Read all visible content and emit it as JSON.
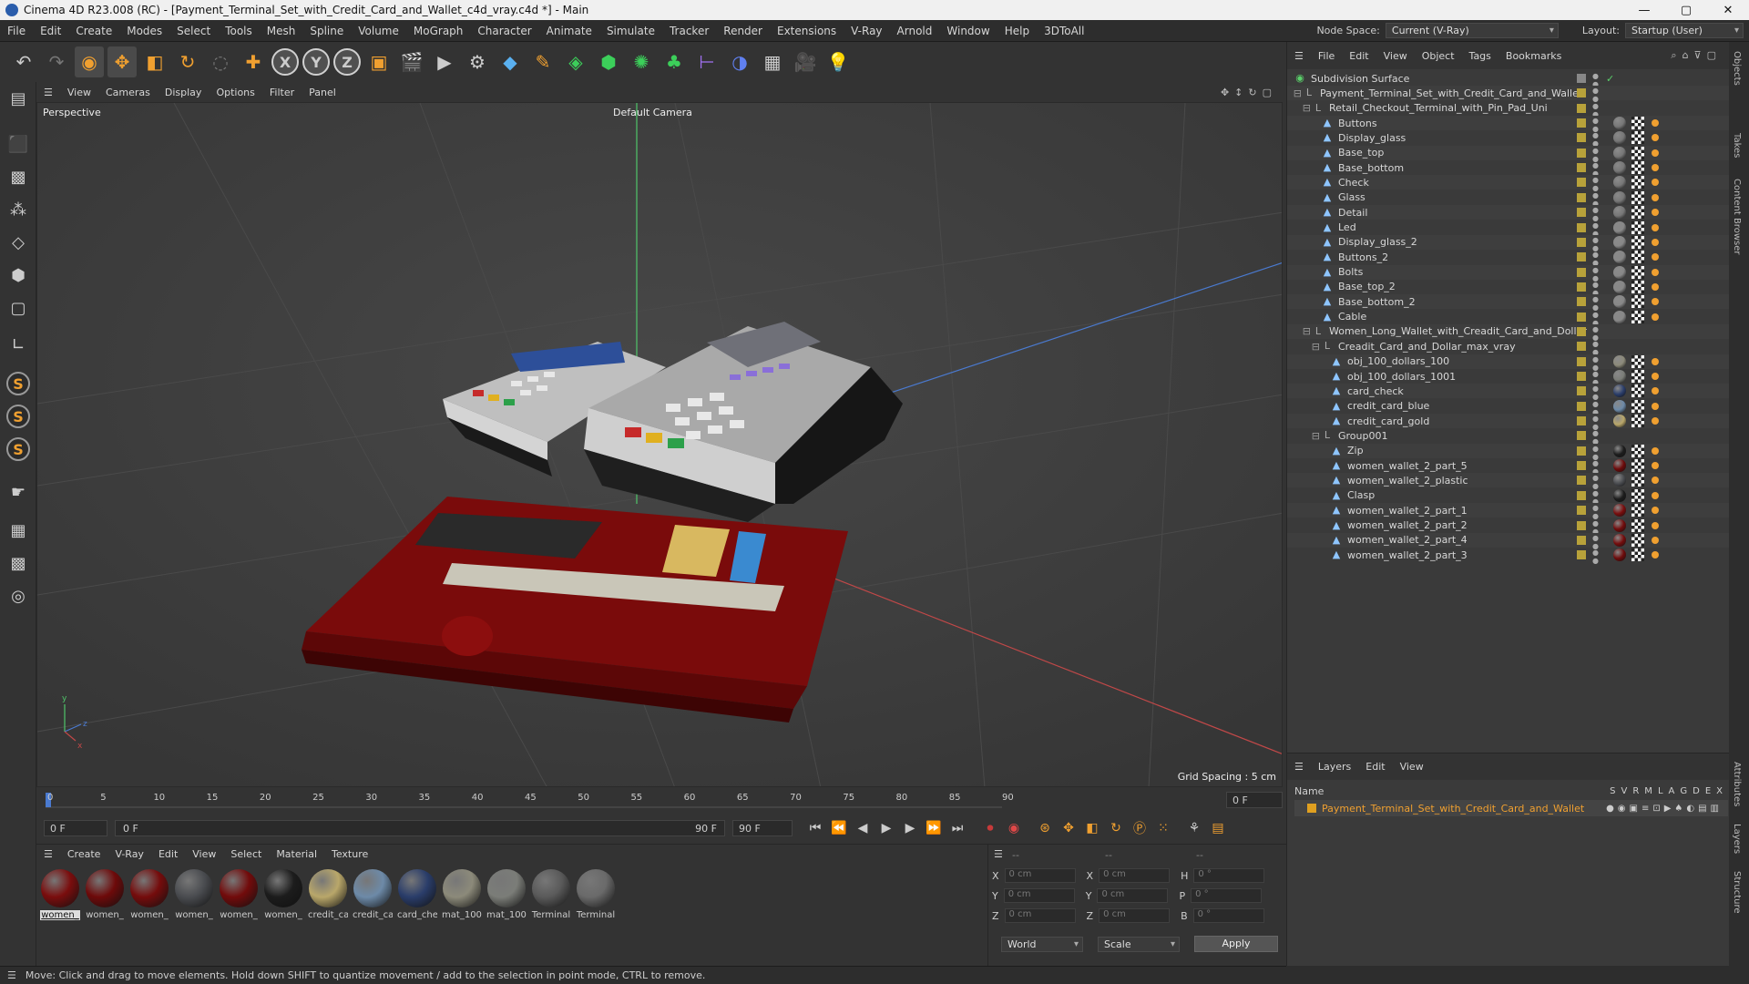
{
  "window": {
    "title": "Cinema 4D R23.008 (RC) - [Payment_Terminal_Set_with_Credit_Card_and_Wallet_c4d_vray.c4d *] - Main",
    "controls": [
      "—",
      "▢",
      "✕"
    ]
  },
  "menubar": {
    "items": [
      "File",
      "Edit",
      "Create",
      "Modes",
      "Select",
      "Tools",
      "Mesh",
      "Spline",
      "Volume",
      "MoGraph",
      "Character",
      "Animate",
      "Simulate",
      "Tracker",
      "Render",
      "Extensions",
      "V-Ray",
      "Arnold",
      "Window",
      "Help",
      "3DToAll"
    ],
    "node_space_label": "Node Space:",
    "node_space_value": "Current (V-Ray)",
    "layout_label": "Layout:",
    "layout_value": "Startup (User)"
  },
  "toolbar": {
    "axis_x": "X",
    "axis_y": "Y",
    "axis_z": "Z"
  },
  "left_tools": {
    "s1": "S",
    "s2": "S",
    "s3": "S"
  },
  "viewport": {
    "menu": [
      "View",
      "Cameras",
      "Display",
      "Options",
      "Filter",
      "Panel"
    ],
    "name": "Perspective",
    "camera": "Default Camera",
    "grid_spacing": "Grid Spacing : 5 cm"
  },
  "timeline": {
    "ticks": [
      "0",
      "5",
      "10",
      "15",
      "20",
      "25",
      "30",
      "35",
      "40",
      "45",
      "50",
      "55",
      "60",
      "65",
      "70",
      "75",
      "80",
      "85",
      "90"
    ],
    "end_field": "0 F",
    "start": "0 F",
    "current": "0 F",
    "range_end": "90 F",
    "max": "90 F"
  },
  "material_manager": {
    "menu": [
      "Create",
      "V-Ray",
      "Edit",
      "View",
      "Select",
      "Material",
      "Texture"
    ],
    "materials": [
      {
        "name": "women_",
        "color": "#7a0d0d"
      },
      {
        "name": "women_",
        "color": "#6e0a0a"
      },
      {
        "name": "women_",
        "color": "#750c0c"
      },
      {
        "name": "women_",
        "color": "#4a4c50"
      },
      {
        "name": "women_",
        "color": "#720b0b"
      },
      {
        "name": "women_",
        "color": "#1c1c1c"
      },
      {
        "name": "credit_ca",
        "color": "#b9a76a"
      },
      {
        "name": "credit_ca",
        "color": "#6d8aa8"
      },
      {
        "name": "card_che",
        "color": "#2a3d6a"
      },
      {
        "name": "mat_100",
        "color": "#8c8a7a"
      },
      {
        "name": "mat_100",
        "color": "#7b7d78"
      },
      {
        "name": "Terminal",
        "color": "#5a5a5a"
      },
      {
        "name": "Terminal",
        "color": "#6a6a6a"
      }
    ]
  },
  "coordinates": {
    "header": [
      "--",
      "--",
      "--"
    ],
    "rows": [
      {
        "a": "X",
        "av": "0 cm",
        "b": "X",
        "bv": "0 cm",
        "c": "H",
        "cv": "0 °"
      },
      {
        "a": "Y",
        "av": "0 cm",
        "b": "Y",
        "bv": "0 cm",
        "c": "P",
        "cv": "0 °"
      },
      {
        "a": "Z",
        "av": "0 cm",
        "b": "Z",
        "bv": "0 cm",
        "c": "B",
        "cv": "0 °"
      }
    ],
    "mode1": "World",
    "mode2": "Scale",
    "apply": "Apply"
  },
  "status": "Move: Click and drag to move elements. Hold down SHIFT to quantize movement / add to the selection in point mode, CTRL to remove.",
  "object_manager": {
    "menu": [
      "File",
      "Edit",
      "View",
      "Object",
      "Tags",
      "Bookmarks"
    ],
    "rows": [
      {
        "name": "Subdivision Surface",
        "indent": 0,
        "type": "sub",
        "tag": ""
      },
      {
        "name": "Payment_Terminal_Set_with_Credit_Card_and_Wallet",
        "indent": 1,
        "type": "null",
        "tag": ""
      },
      {
        "name": "Retail_Checkout_Terminal_with_Pin_Pad_Uni",
        "indent": 2,
        "type": "null",
        "tag": ""
      },
      {
        "name": "Buttons",
        "indent": 3,
        "type": "obj",
        "tag": "#777"
      },
      {
        "name": "Display_glass",
        "indent": 3,
        "type": "obj",
        "tag": "#777"
      },
      {
        "name": "Base_top",
        "indent": 3,
        "type": "obj",
        "tag": "#777"
      },
      {
        "name": "Base_bottom",
        "indent": 3,
        "type": "obj",
        "tag": "#777"
      },
      {
        "name": "Check",
        "indent": 3,
        "type": "obj",
        "tag": "#777"
      },
      {
        "name": "Glass",
        "indent": 3,
        "type": "obj",
        "tag": "#777"
      },
      {
        "name": "Detail",
        "indent": 3,
        "type": "obj",
        "tag": "#777"
      },
      {
        "name": "Led",
        "indent": 3,
        "type": "obj",
        "tag": "#888"
      },
      {
        "name": "Display_glass_2",
        "indent": 3,
        "type": "obj",
        "tag": "#888"
      },
      {
        "name": "Buttons_2",
        "indent": 3,
        "type": "obj",
        "tag": "#888"
      },
      {
        "name": "Bolts",
        "indent": 3,
        "type": "obj",
        "tag": "#888"
      },
      {
        "name": "Base_top_2",
        "indent": 3,
        "type": "obj",
        "tag": "#888"
      },
      {
        "name": "Base_bottom_2",
        "indent": 3,
        "type": "obj",
        "tag": "#888"
      },
      {
        "name": "Cable",
        "indent": 3,
        "type": "obj",
        "tag": "#888"
      },
      {
        "name": "Women_Long_Wallet_with_Creadit_Card_and_Dollar",
        "indent": 2,
        "type": "null",
        "tag": ""
      },
      {
        "name": "Creadit_Card_and_Dollar_max_vray",
        "indent": 3,
        "type": "null",
        "tag": ""
      },
      {
        "name": "obj_100_dollars_100",
        "indent": 4,
        "type": "obj",
        "tag": "#8c8a7a"
      },
      {
        "name": "obj_100_dollars_1001",
        "indent": 4,
        "type": "obj",
        "tag": "#7b7d78"
      },
      {
        "name": "card_check",
        "indent": 4,
        "type": "obj",
        "tag": "#2a3d6a"
      },
      {
        "name": "credit_card_blue",
        "indent": 4,
        "type": "obj",
        "tag": "#6d8aa8"
      },
      {
        "name": "credit_card_gold",
        "indent": 4,
        "type": "obj",
        "tag": "#b9a76a"
      },
      {
        "name": "Group001",
        "indent": 3,
        "type": "null",
        "tag": ""
      },
      {
        "name": "Zip",
        "indent": 4,
        "type": "obj",
        "tag": "#1c1c1c"
      },
      {
        "name": "women_wallet_2_part_5",
        "indent": 4,
        "type": "obj",
        "tag": "#6e0a0a"
      },
      {
        "name": "women_wallet_2_plastic",
        "indent": 4,
        "type": "obj",
        "tag": "#4a4c50"
      },
      {
        "name": "Clasp",
        "indent": 4,
        "type": "obj",
        "tag": "#1c1c1c"
      },
      {
        "name": "women_wallet_2_part_1",
        "indent": 4,
        "type": "obj",
        "tag": "#7a0d0d"
      },
      {
        "name": "women_wallet_2_part_2",
        "indent": 4,
        "type": "obj",
        "tag": "#720b0b"
      },
      {
        "name": "women_wallet_2_part_4",
        "indent": 4,
        "type": "obj",
        "tag": "#750c0c"
      },
      {
        "name": "women_wallet_2_part_3",
        "indent": 4,
        "type": "obj",
        "tag": "#6e0a0a"
      }
    ]
  },
  "layer_manager": {
    "menu": [
      "Layers",
      "Edit",
      "View"
    ],
    "col_name": "Name",
    "cols": [
      "S",
      "V",
      "R",
      "M",
      "L",
      "A",
      "G",
      "D",
      "E",
      "X"
    ],
    "layer": "Payment_Terminal_Set_with_Credit_Card_and_Wallet",
    "layer_color": "#e0a020"
  },
  "side_tabs": [
    "Objects",
    "Takes",
    "Content Browser",
    "Attributes",
    "Layers",
    "Structure"
  ]
}
